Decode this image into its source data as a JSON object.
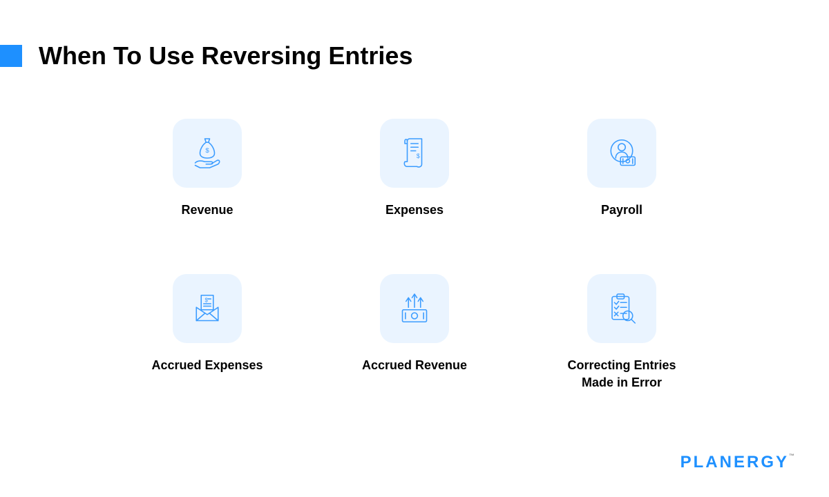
{
  "title": "When To Use Reversing Entries",
  "items": [
    {
      "label": "Revenue",
      "icon": "money-bag-hand-icon"
    },
    {
      "label": "Expenses",
      "icon": "receipt-icon"
    },
    {
      "label": "Payroll",
      "icon": "person-cash-icon"
    },
    {
      "label": "Accrued Expenses",
      "icon": "envelope-document-icon"
    },
    {
      "label": "Accrued Revenue",
      "icon": "cash-arrows-icon"
    },
    {
      "label": "Correcting Entries Made in Error",
      "icon": "clipboard-check-icon"
    }
  ],
  "brand": "PLANERGY",
  "colors": {
    "accent": "#1e90ff",
    "icon_bg": "#eaf4ff",
    "icon_stroke": "#3b9cff"
  }
}
